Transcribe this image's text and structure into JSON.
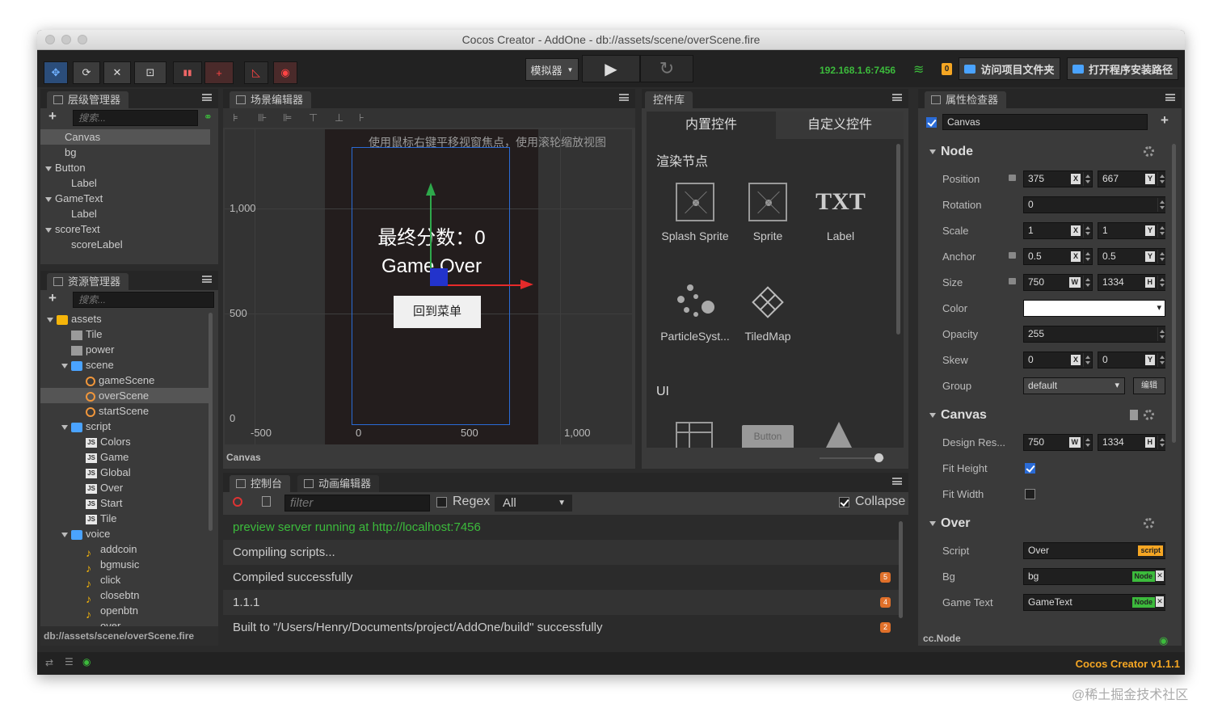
{
  "window": {
    "title": "Cocos Creator - AddOne - db://assets/scene/overScene.fire"
  },
  "toolbar": {
    "simulator_label": "模拟器",
    "ip": "192.168.1.6:7456",
    "notify_count": "0",
    "open_project_label": "访问项目文件夹",
    "open_install_label": "打开程序安装路径"
  },
  "hierarchy": {
    "tab": "层级管理器",
    "search_placeholder": "搜索...",
    "nodes": [
      {
        "label": "Canvas",
        "depth": 0,
        "expanded": null,
        "selected": true
      },
      {
        "label": "bg",
        "depth": 0,
        "expanded": null
      },
      {
        "label": "Button",
        "depth": 0,
        "expanded": true
      },
      {
        "label": "Label",
        "depth": 1,
        "expanded": null
      },
      {
        "label": "GameText",
        "depth": 0,
        "expanded": true
      },
      {
        "label": "Label",
        "depth": 1,
        "expanded": null
      },
      {
        "label": "scoreText",
        "depth": 0,
        "expanded": true
      },
      {
        "label": "scoreLabel",
        "depth": 1,
        "expanded": null
      }
    ]
  },
  "assets": {
    "tab": "资源管理器",
    "search_placeholder": "搜索...",
    "items": [
      {
        "label": "assets",
        "depth": 0,
        "kind": "assets",
        "expanded": true
      },
      {
        "label": "Tile",
        "depth": 1,
        "kind": "prefab"
      },
      {
        "label": "power",
        "depth": 1,
        "kind": "prefab"
      },
      {
        "label": "scene",
        "depth": 1,
        "kind": "folder",
        "expanded": true
      },
      {
        "label": "gameScene",
        "depth": 2,
        "kind": "fire"
      },
      {
        "label": "overScene",
        "depth": 2,
        "kind": "fire",
        "selected": true
      },
      {
        "label": "startScene",
        "depth": 2,
        "kind": "fire"
      },
      {
        "label": "script",
        "depth": 1,
        "kind": "folder",
        "expanded": true
      },
      {
        "label": "Colors",
        "depth": 2,
        "kind": "js"
      },
      {
        "label": "Game",
        "depth": 2,
        "kind": "js"
      },
      {
        "label": "Global",
        "depth": 2,
        "kind": "js"
      },
      {
        "label": "Over",
        "depth": 2,
        "kind": "js"
      },
      {
        "label": "Start",
        "depth": 2,
        "kind": "js"
      },
      {
        "label": "Tile",
        "depth": 2,
        "kind": "js"
      },
      {
        "label": "voice",
        "depth": 1,
        "kind": "folder",
        "expanded": true
      },
      {
        "label": "addcoin",
        "depth": 2,
        "kind": "music"
      },
      {
        "label": "bgmusic",
        "depth": 2,
        "kind": "music"
      },
      {
        "label": "click",
        "depth": 2,
        "kind": "music"
      },
      {
        "label": "closebtn",
        "depth": 2,
        "kind": "music"
      },
      {
        "label": "openbtn",
        "depth": 2,
        "kind": "music"
      },
      {
        "label": "over",
        "depth": 2,
        "kind": "music"
      }
    ],
    "status_path": "db://assets/scene/overScene.fire"
  },
  "scene": {
    "tab": "场景编辑器",
    "hint": "使用鼠标右键平移视窗焦点，使用滚轮缩放视图",
    "y_ticks": [
      "1,000",
      "500",
      "0"
    ],
    "x_ticks": [
      "-500",
      "0",
      "500",
      "1,000"
    ],
    "score_text": "最终分数：0",
    "game_over_text": "Game Over",
    "button_text": "回到菜单",
    "footer": "Canvas"
  },
  "widgets": {
    "tab": "控件库",
    "builtin_tab": "内置控件",
    "custom_tab": "自定义控件",
    "section_render": "渲染节点",
    "section_ui": "UI",
    "items": [
      {
        "label": "Splash Sprite",
        "icon": "splash-sprite-icon"
      },
      {
        "label": "Sprite",
        "icon": "sprite-icon"
      },
      {
        "label": "Label",
        "icon": "label-icon",
        "glyph": "TXT"
      },
      {
        "label": "ParticleSyst...",
        "icon": "particle-icon"
      },
      {
        "label": "TiledMap",
        "icon": "tiledmap-icon"
      }
    ],
    "ui_button_text": "Button"
  },
  "console": {
    "tab": "控制台",
    "anim_tab": "动画编辑器",
    "filter_placeholder": "filter",
    "regex_label": "Regex",
    "level_select": "All",
    "collapse_label": "Collapse",
    "logs": [
      {
        "text": "preview server running at http://localhost:7456",
        "color": "#3cbb3c",
        "count": null
      },
      {
        "text": "Compiling scripts...",
        "color": "#cccccc",
        "count": null
      },
      {
        "text": "Compiled successfully",
        "color": "#cccccc",
        "count": "5"
      },
      {
        "text": "1.1.1",
        "color": "#cccccc",
        "count": "4"
      },
      {
        "text": "Built to \"/Users/Henry/Documents/project/AddOne/build\" successfully",
        "color": "#cccccc",
        "count": "2"
      }
    ]
  },
  "inspector": {
    "tab": "属性检查器",
    "node_name": "Canvas",
    "node_section": "Node",
    "position": {
      "label": "Position",
      "x": "375",
      "y": "667"
    },
    "rotation": {
      "label": "Rotation",
      "value": "0"
    },
    "scale": {
      "label": "Scale",
      "x": "1",
      "y": "1"
    },
    "anchor": {
      "label": "Anchor",
      "x": "0.5",
      "y": "0.5"
    },
    "size": {
      "label": "Size",
      "w": "750",
      "h": "1334"
    },
    "color": {
      "label": "Color",
      "value": "#ffffff"
    },
    "opacity": {
      "label": "Opacity",
      "value": "255"
    },
    "skew": {
      "label": "Skew",
      "x": "0",
      "y": "0"
    },
    "group": {
      "label": "Group",
      "value": "default",
      "edit": "编辑"
    },
    "canvas_section": "Canvas",
    "design_res": {
      "label": "Design Res...",
      "w": "750",
      "h": "1334"
    },
    "fit_height": {
      "label": "Fit Height",
      "checked": true
    },
    "fit_width": {
      "label": "Fit Width",
      "checked": false
    },
    "over_section": "Over",
    "script": {
      "label": "Script",
      "value": "Over",
      "tag": "script"
    },
    "bg": {
      "label": "Bg",
      "value": "bg",
      "tag": "Node"
    },
    "game_text": {
      "label": "Game Text",
      "value": "GameText",
      "tag": "Node"
    },
    "footer_type": "cc.Node"
  },
  "statusbar": {
    "version": "Cocos Creator v1.1.1"
  },
  "watermark": "@稀土掘金技术社区",
  "axis_labels": {
    "x": "X",
    "y": "Y",
    "w": "W",
    "h": "H"
  },
  "colors": {
    "accent": "#f5a623",
    "ip": "#3cbb3c",
    "selection": "#2a6bd6",
    "canvas_frame": "#2a6bd6"
  }
}
